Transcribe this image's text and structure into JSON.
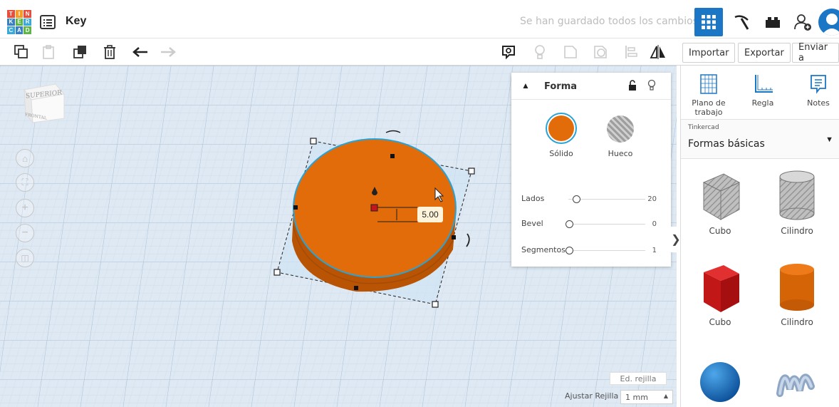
{
  "app": {
    "logo_letters": [
      "T",
      "I",
      "N",
      "K",
      "E",
      "R",
      "C",
      "A",
      "D"
    ],
    "document_title": "Key",
    "save_status": "Se han guardado todos los cambios."
  },
  "toolbar": {
    "import_label": "Importar",
    "export_label": "Exportar",
    "send_label": "Enviar a"
  },
  "workplane": {
    "viewcube_top": "SUPERIOR",
    "viewcube_front": "FRONTAL",
    "dimension_value": "5.00",
    "edit_grid_label": "Ed. rejilla",
    "snap_grid_label": "Ajustar Rejilla",
    "snap_grid_value": "1 mm",
    "shape_color": "#e26b0a",
    "grid_color": "#dfe9f3"
  },
  "shape_panel": {
    "title": "Forma",
    "solid_label": "Sólido",
    "hole_label": "Hueco",
    "params": [
      {
        "label": "Lados",
        "value": "20"
      },
      {
        "label": "Bevel",
        "value": "0"
      },
      {
        "label": "Segmentos",
        "value": "1"
      }
    ]
  },
  "sidebar": {
    "tools": [
      {
        "label": "Plano de trabajo",
        "icon": "workplane-icon"
      },
      {
        "label": "Regla",
        "icon": "ruler-icon"
      },
      {
        "label": "Notes",
        "icon": "notes-icon"
      }
    ],
    "category_source": "Tinkercad",
    "category_name": "Formas básicas",
    "shapes": [
      {
        "label": "Cubo",
        "icon": "cube-gray-icon"
      },
      {
        "label": "Cilindro",
        "icon": "cylinder-gray-icon"
      },
      {
        "label": "Cubo",
        "icon": "cube-red-icon"
      },
      {
        "label": "Cilindro",
        "icon": "cylinder-orange-icon"
      },
      {
        "label": "",
        "icon": "sphere-blue-icon"
      },
      {
        "label": "",
        "icon": "scribble-icon"
      }
    ]
  }
}
